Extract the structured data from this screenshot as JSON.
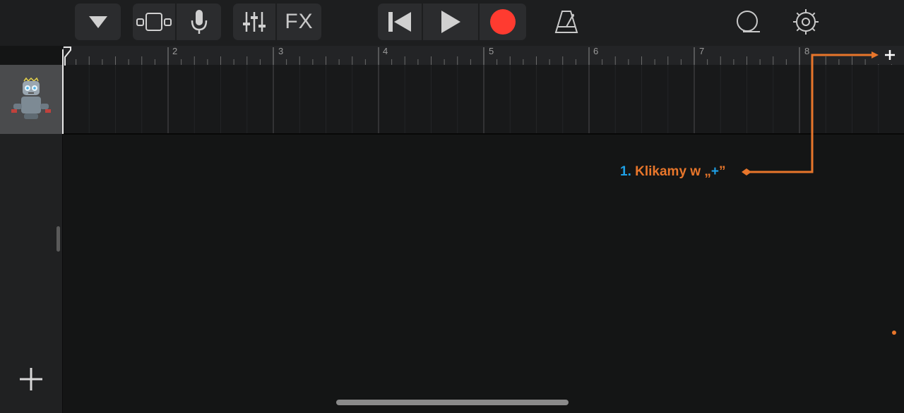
{
  "toolbar": {
    "fx_label": "FX",
    "record_color": "#ff3b30"
  },
  "ruler": {
    "bar_numbers": [
      "2",
      "3",
      "4",
      "5",
      "6",
      "7",
      "8"
    ]
  },
  "track": {
    "instrument_icon": "robot-drummer-icon"
  },
  "callout": {
    "number": "1.",
    "text_before": "Klikamy w „",
    "highlight": "+",
    "text_after": "”",
    "color": "#e8762b",
    "highlight_color": "#1ea0e6"
  },
  "icons": [
    "track-view-icon",
    "loop-browser-icon",
    "microphone-icon",
    "mixer-icon",
    "rewind-icon",
    "play-icon",
    "record-icon",
    "metronome-icon",
    "loops-icon",
    "settings-gear-icon",
    "plus-icon"
  ]
}
